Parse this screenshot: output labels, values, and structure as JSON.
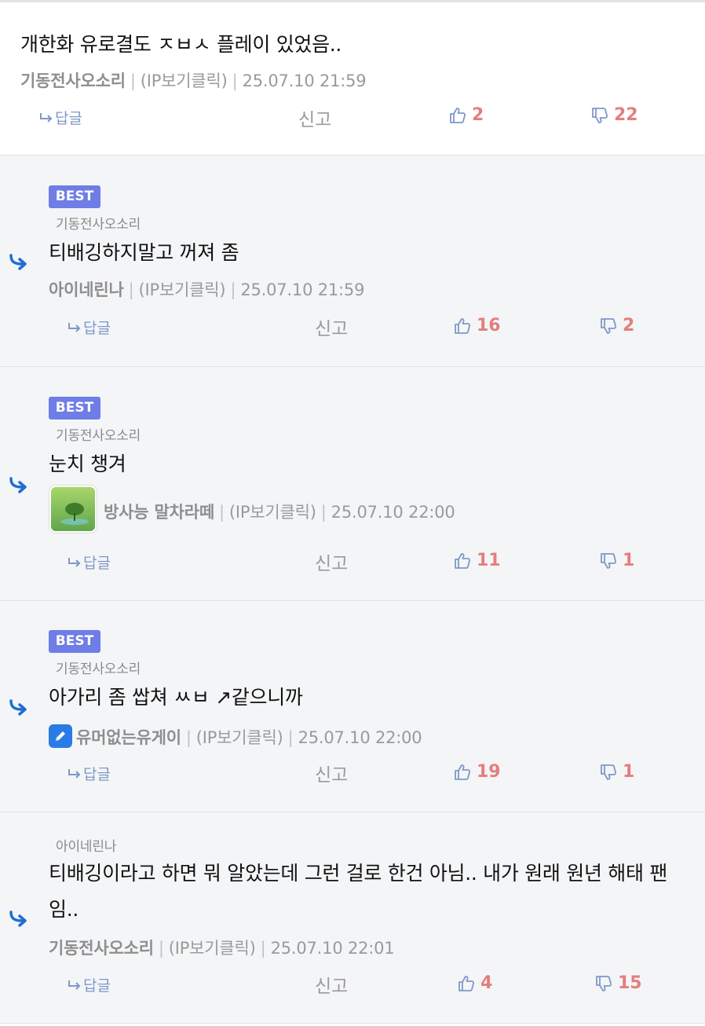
{
  "labels": {
    "reply": "답글",
    "report": "신고",
    "meta_sep": "|",
    "ip": "(IP보기클릭)"
  },
  "comments": [
    {
      "best": "",
      "parent": "",
      "text": "개한화 유로결도 ㅈㅂㅅ 플레이 있었음..",
      "author": "기동전사오소리",
      "time": "25.07.10 21:59",
      "likes": "2",
      "dislikes": "22"
    },
    {
      "best": "BEST",
      "parent": "기동전사오소리",
      "text": "티배깅하지말고 꺼져 좀",
      "author": "아이네린나",
      "time": "25.07.10 21:59",
      "likes": "16",
      "dislikes": "2"
    },
    {
      "best": "BEST",
      "parent": "기동전사오소리",
      "text": "눈치 챙겨",
      "author": "방사능 말차라떼",
      "time": "25.07.10 22:00",
      "likes": "11",
      "dislikes": "1"
    },
    {
      "best": "BEST",
      "parent": "기동전사오소리",
      "text": "아가리 좀 쌉쳐 ㅆㅂ ↗같으니까",
      "author": "유머없는유게이",
      "time": "25.07.10 22:00",
      "likes": "19",
      "dislikes": "1"
    },
    {
      "best": "",
      "parent": "아이네린나",
      "text": "티배깅이라고 하면 뭐 알았는데 그런 걸로 한건 아님.. 내가 원래 원년 해태 팬임..",
      "author": "기동전사오소리",
      "time": "25.07.10 22:01",
      "likes": "4",
      "dislikes": "15"
    }
  ],
  "colors": {
    "best_badge": "#6f7de6",
    "vote_count": "#e47e7e",
    "reply_link": "#7f98c7",
    "reply_arrow": "#1e6fd1",
    "background_reply": "#f4f5f7"
  },
  "icons": [
    "reply-arrow-icon",
    "thumbs-up-icon",
    "thumbs-down-icon",
    "pencil-icon"
  ]
}
